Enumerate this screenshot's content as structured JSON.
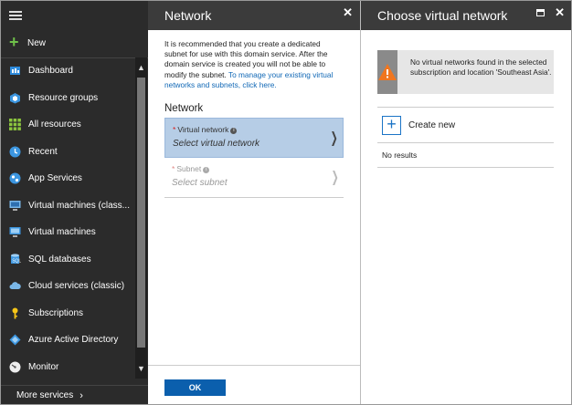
{
  "sidebar": {
    "new_label": "New",
    "items": [
      {
        "label": "Dashboard",
        "icon": "dashboard-icon"
      },
      {
        "label": "Resource groups",
        "icon": "resource-groups-icon"
      },
      {
        "label": "All resources",
        "icon": "all-resources-icon"
      },
      {
        "label": "Recent",
        "icon": "recent-icon"
      },
      {
        "label": "App Services",
        "icon": "app-services-icon"
      },
      {
        "label": "Virtual machines (classic)",
        "icon": "vm-classic-icon"
      },
      {
        "label": "Virtual machines",
        "icon": "vm-icon"
      },
      {
        "label": "SQL databases",
        "icon": "sql-icon"
      },
      {
        "label": "Cloud services (classic)",
        "icon": "cloud-icon"
      },
      {
        "label": "Subscriptions",
        "icon": "key-icon"
      },
      {
        "label": "Azure Active Directory",
        "icon": "aad-icon"
      },
      {
        "label": "Monitor",
        "icon": "monitor-icon"
      }
    ],
    "more_label": "More services"
  },
  "network_blade": {
    "title": "Network",
    "intro": "It is recommended that you create a dedicated subnet for use with this domain service. After the domain service is created you will not be able to modify the subnet. ",
    "intro_link": "To manage your existing virtual networks and subnets, click here.",
    "section_title": "Network",
    "vnet_label": "Virtual network",
    "vnet_placeholder": "Select virtual network",
    "subnet_label": "Subnet",
    "subnet_placeholder": "Select subnet",
    "ok_label": "OK"
  },
  "choose_blade": {
    "title": "Choose virtual network",
    "warning": "No virtual networks found in the selected subscription and location 'Southeast Asia'.",
    "create_label": "Create new",
    "no_results": "No results"
  },
  "colors": {
    "accent": "#0b5fad",
    "selected_field": "#b6cde6",
    "sidebar_bg": "#2b2b2b",
    "header_bg": "#3b3b3b",
    "new_plus": "#6fc04a",
    "warning_orange": "#f0761f"
  }
}
